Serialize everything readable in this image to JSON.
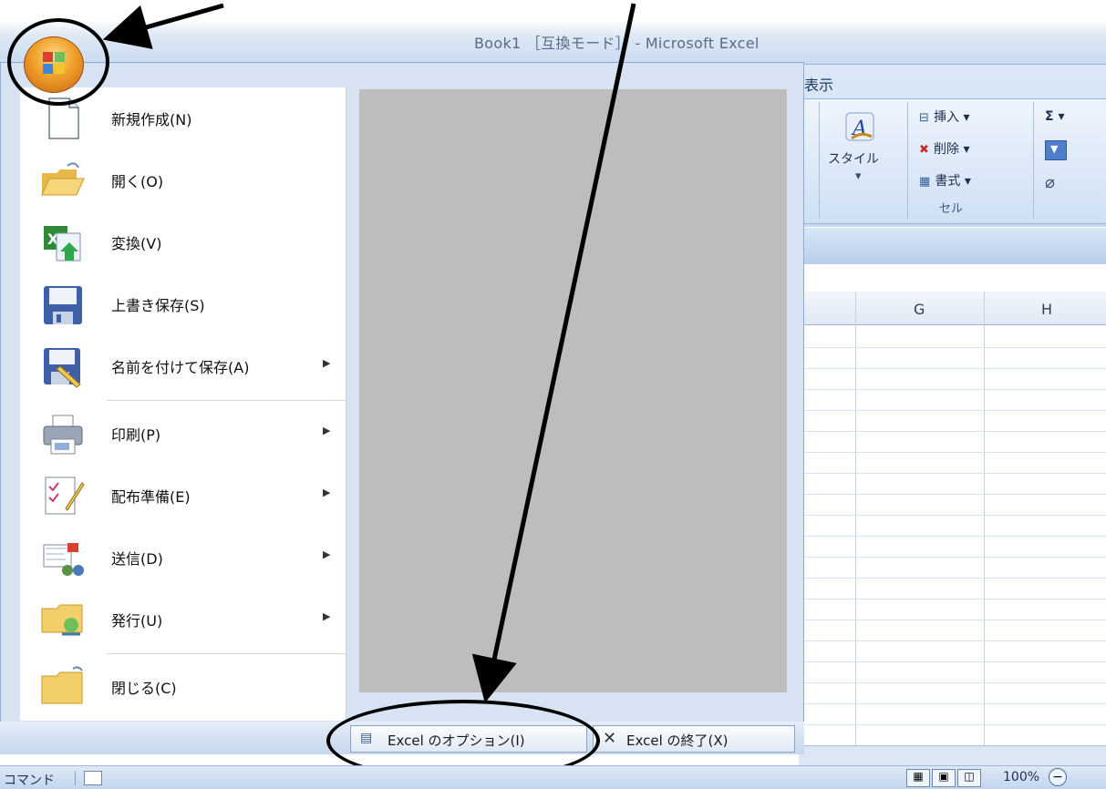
{
  "window": {
    "title": "Book1 ［互換モード］ - Microsoft Excel"
  },
  "ribbon": {
    "tab_view": "表示",
    "style_label": "スタイル",
    "insert_label": "挿入 ▾",
    "delete_label": "削除 ▾",
    "format_label": "書式 ▾",
    "cells_group": "セル",
    "sum_symbol": "Σ ▾"
  },
  "sheet": {
    "columns": [
      "G",
      "H"
    ]
  },
  "office_menu": {
    "items": [
      {
        "label": "新規作成(N)",
        "icon": "new-document-icon",
        "has_submenu": false
      },
      {
        "label": "開く(O)",
        "icon": "open-folder-icon",
        "has_submenu": false
      },
      {
        "label": "変換(V)",
        "icon": "convert-icon",
        "has_submenu": false
      },
      {
        "label": "上書き保存(S)",
        "icon": "save-icon",
        "has_submenu": false
      },
      {
        "label": "名前を付けて保存(A)",
        "icon": "save-as-icon",
        "has_submenu": true
      },
      {
        "label": "印刷(P)",
        "icon": "printer-icon",
        "has_submenu": true
      },
      {
        "label": "配布準備(E)",
        "icon": "prepare-icon",
        "has_submenu": true
      },
      {
        "label": "送信(D)",
        "icon": "send-icon",
        "has_submenu": true
      },
      {
        "label": "発行(U)",
        "icon": "publish-icon",
        "has_submenu": true
      },
      {
        "label": "閉じる(C)",
        "icon": "close-folder-icon",
        "has_submenu": false
      }
    ],
    "submenu_arrow": "▶",
    "options_button": "Excel のオプション(I)",
    "exit_button": "Excel の終了(X)"
  },
  "statusbar": {
    "mode": "コマンド",
    "zoom": "100%"
  },
  "colors": {
    "ribbon": "#c7daf2",
    "menu_bg": "#d7e3f2",
    "recent_bg": "#bdbdbd",
    "annotation": "#000000"
  }
}
